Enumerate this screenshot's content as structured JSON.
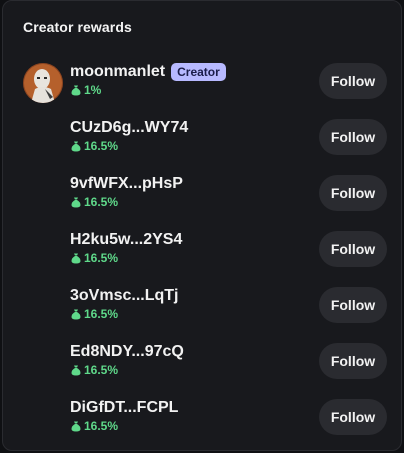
{
  "panel": {
    "title": "Creator rewards",
    "follow_label": "Follow",
    "accent_green": "#5fd98a",
    "badge_color": "#b7b9ff"
  },
  "rows": [
    {
      "name": "moonmanlet",
      "badge": "Creator",
      "percent": "1%",
      "has_avatar": true
    },
    {
      "name": "CUzD6g...WY74",
      "percent": "16.5%"
    },
    {
      "name": "9vfWFX...pHsP",
      "percent": "16.5%"
    },
    {
      "name": "H2ku5w...2YS4",
      "percent": "16.5%"
    },
    {
      "name": "3oVmsc...LqTj",
      "percent": "16.5%"
    },
    {
      "name": "Ed8NDY...97cQ",
      "percent": "16.5%"
    },
    {
      "name": "DiGfDT...FCPL",
      "percent": "16.5%"
    }
  ]
}
